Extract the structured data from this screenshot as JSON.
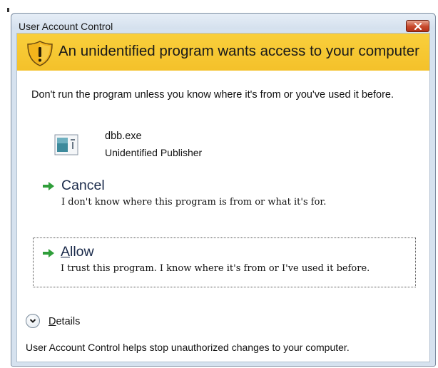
{
  "window": {
    "title": "User Account Control"
  },
  "banner": {
    "text": "An unidentified program wants access to your computer",
    "color": "#f6c530"
  },
  "warning": {
    "text": "Don't run the program unless you know where it's from or you've used it before."
  },
  "program": {
    "name": "dbb.exe",
    "publisher": "Unidentified Publisher",
    "icon": "program-file-icon"
  },
  "options": {
    "cancel": {
      "title": "Cancel",
      "description": "I don't know where this program is from or what it's for.",
      "icon": "green-arrow-icon"
    },
    "allow": {
      "title_accel": "A",
      "title_rest": "llow",
      "description": "I trust this program. I know where it's from or I've used it before.",
      "icon": "green-arrow-icon"
    }
  },
  "details": {
    "label_accel": "D",
    "label_rest": "etails",
    "icon": "chevron-down-icon"
  },
  "footer": {
    "text": "User Account Control helps stop unauthorized changes to your computer."
  },
  "colors": {
    "accent_arrow": "#2f9e3a",
    "close_button": "#c7482c"
  }
}
